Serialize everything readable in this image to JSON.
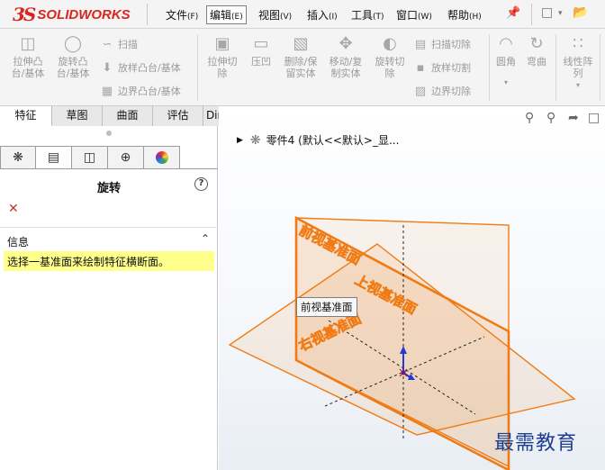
{
  "app": {
    "logo_ds": "3S",
    "logo_text": "SOLIDWORKS"
  },
  "menu": [
    {
      "label": "文件",
      "key": "(F)"
    },
    {
      "label": "编辑",
      "key": "(E)"
    },
    {
      "label": "视图",
      "key": "(V)"
    },
    {
      "label": "插入",
      "key": "(I)"
    },
    {
      "label": "工具",
      "key": "(T)"
    },
    {
      "label": "窗口",
      "key": "(W)"
    },
    {
      "label": "帮助",
      "key": "(H)"
    }
  ],
  "ribbon": {
    "extrude_boss": "拉伸凸\n台/基体",
    "revolve_boss": "旋转凸\n台/基体",
    "sweep": "扫描",
    "loft": "放样凸台/基体",
    "boundary_boss": "边界凸台/基体",
    "extrude_cut": "拉伸切\n除",
    "indent": "压凹",
    "delete_keep": "删除/保\n留实体",
    "move_copy": "移动/复\n制实体",
    "revolve_cut": "旋转切\n除",
    "sweep_cut": "扫描切除",
    "loft_cut": "放样切割",
    "boundary_cut": "边界切除",
    "fillet": "圆角",
    "bend": "弯曲",
    "linear_pattern": "线性阵\n列"
  },
  "tabs": [
    "特征",
    "草图",
    "曲面",
    "评估",
    "DimXpert"
  ],
  "panel": {
    "title": "旋转",
    "help": "?",
    "info_title": "信息",
    "info_message": "选择一基准面来绘制特征横断面。"
  },
  "viewport": {
    "tree_label": "零件4 (默认<<默认>_显...",
    "tooltip": "前视基准面",
    "plane_front": "前视基准面",
    "plane_top": "上视基准面",
    "plane_right": "右视基准面",
    "watermark": "最需教育"
  },
  "colors": {
    "plane_orange": "#f07b14",
    "axis_blue": "#1f3bd6",
    "info_yellow": "#ffff8c",
    "logo_red": "#d8261f"
  },
  "icons": [
    "extrude-boss-icon",
    "revolve-boss-icon",
    "sweep-icon",
    "loft-icon",
    "boundary-icon",
    "extrude-cut-icon",
    "indent-icon",
    "delete-body-icon",
    "move-body-icon",
    "revolve-cut-icon",
    "fillet-icon",
    "bend-icon",
    "linear-pattern-icon",
    "zoom-fit-icon",
    "zoom-area-icon",
    "section-icon",
    "pin-icon",
    "new-doc-icon"
  ]
}
